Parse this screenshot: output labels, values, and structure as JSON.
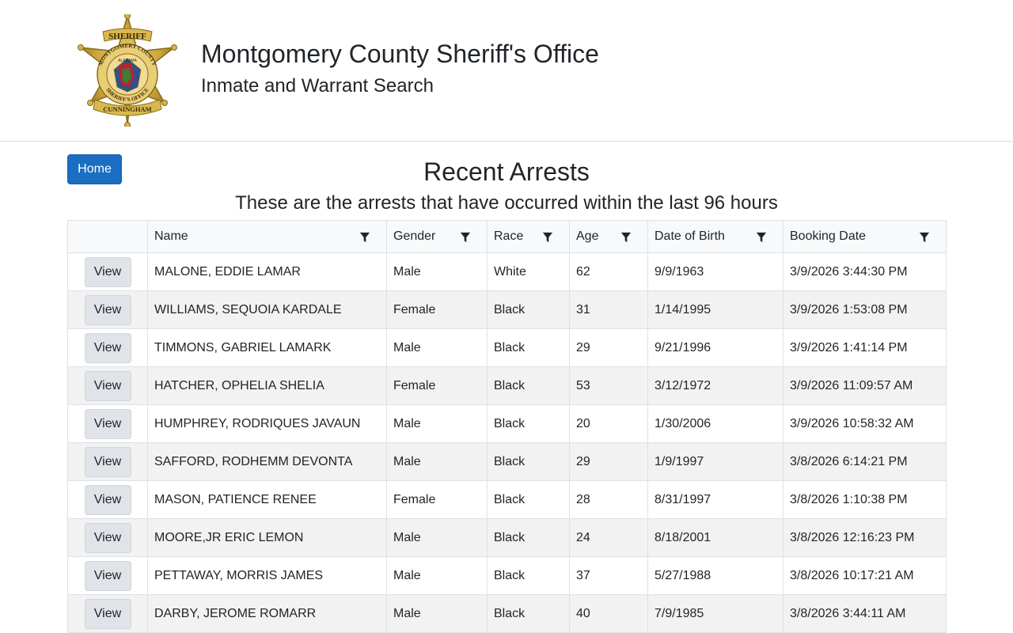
{
  "header": {
    "title": "Montgomery County Sheriff's Office",
    "subtitle": "Inmate and Warrant Search",
    "logo": {
      "top_text": "SHERIFF",
      "ring_text": "MONTGOMERY COUNTY",
      "inner_text": "ALABAMA",
      "bottom_text": "SHERIFF'S OFFICE",
      "banner_text": "CUNNINGHAM",
      "colors": {
        "gold": "#c9a53a",
        "dark_gold": "#8a6a1a",
        "red": "#b3262d",
        "blue": "#2f4f8f",
        "green": "#3f7a3a"
      }
    }
  },
  "nav": {
    "home_label": "Home"
  },
  "page": {
    "title": "Recent Arrests",
    "subtitle": "These are the arrests that have occurred within the last 96 hours"
  },
  "table": {
    "view_label": "View",
    "columns": [
      "Name",
      "Gender",
      "Race",
      "Age",
      "Date of Birth",
      "Booking Date"
    ],
    "rows": [
      {
        "name": "MALONE, EDDIE LAMAR",
        "gender": "Male",
        "race": "White",
        "age": "62",
        "dob": "9/9/1963",
        "booking": "3/9/2026 3:44:30 PM"
      },
      {
        "name": "WILLIAMS, SEQUOIA KARDALE",
        "gender": "Female",
        "race": "Black",
        "age": "31",
        "dob": "1/14/1995",
        "booking": "3/9/2026 1:53:08 PM"
      },
      {
        "name": "TIMMONS, GABRIEL LAMARK",
        "gender": "Male",
        "race": "Black",
        "age": "29",
        "dob": "9/21/1996",
        "booking": "3/9/2026 1:41:14 PM"
      },
      {
        "name": "HATCHER, OPHELIA SHELIA",
        "gender": "Female",
        "race": "Black",
        "age": "53",
        "dob": "3/12/1972",
        "booking": "3/9/2026 11:09:57 AM"
      },
      {
        "name": "HUMPHREY, RODRIQUES JAVAUN",
        "gender": "Male",
        "race": "Black",
        "age": "20",
        "dob": "1/30/2006",
        "booking": "3/9/2026 10:58:32 AM"
      },
      {
        "name": "SAFFORD, RODHEMM DEVONTA",
        "gender": "Male",
        "race": "Black",
        "age": "29",
        "dob": "1/9/1997",
        "booking": "3/8/2026 6:14:21 PM"
      },
      {
        "name": "MASON, PATIENCE RENEE",
        "gender": "Female",
        "race": "Black",
        "age": "28",
        "dob": "8/31/1997",
        "booking": "3/8/2026 1:10:38 PM"
      },
      {
        "name": "MOORE,JR ERIC LEMON",
        "gender": "Male",
        "race": "Black",
        "age": "24",
        "dob": "8/18/2001",
        "booking": "3/8/2026 12:16:23 PM"
      },
      {
        "name": "PETTAWAY, MORRIS JAMES",
        "gender": "Male",
        "race": "Black",
        "age": "37",
        "dob": "5/27/1988",
        "booking": "3/8/2026 10:17:21 AM"
      },
      {
        "name": "DARBY, JEROME ROMARR",
        "gender": "Male",
        "race": "Black",
        "age": "40",
        "dob": "7/9/1985",
        "booking": "3/8/2026 3:44:11 AM"
      }
    ]
  },
  "icons": {
    "logo": "sheriff-star-badge-icon",
    "filter": "funnel-filter-icon"
  }
}
